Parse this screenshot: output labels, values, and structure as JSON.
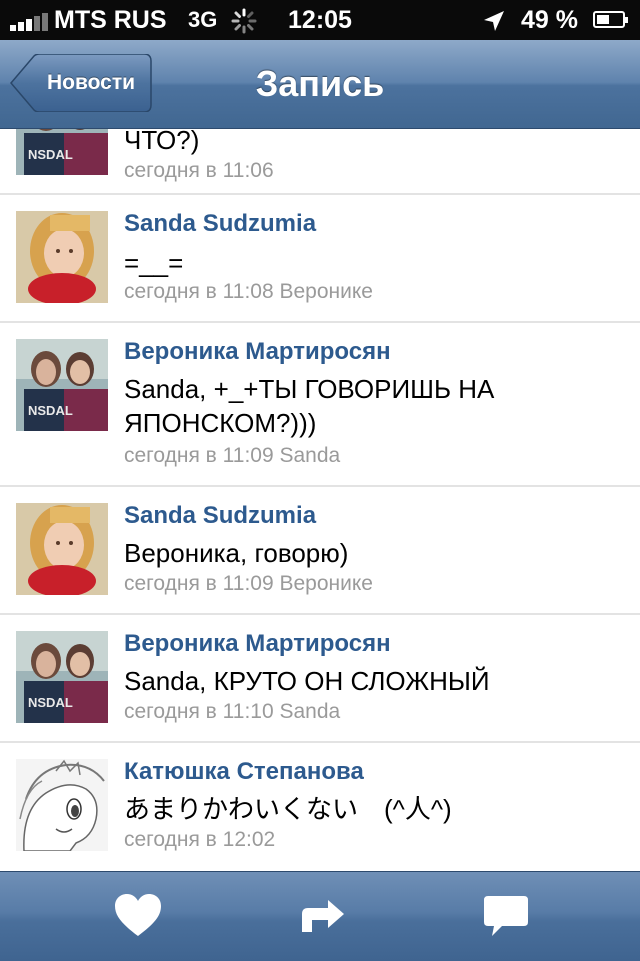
{
  "status_bar": {
    "carrier": "MTS RUS",
    "network": "3G",
    "time": "12:05",
    "battery": "49 %",
    "battery_level": 0.49
  },
  "nav": {
    "back_label": "Новости",
    "title": "Запись"
  },
  "comments": [
    {
      "text": "ЧТО?)",
      "meta": "сегодня в 11:06",
      "avatar": "avatar-veronika"
    },
    {
      "author": "Sanda Sudzumia",
      "text": "=__=",
      "meta": "сегодня в 11:08 Веронике",
      "avatar": "avatar-sanda"
    },
    {
      "author": "Вероника Мартиросян",
      "text": "Sanda, +_+ТЫ ГОВОРИШЬ НА ЯПОНСКОМ?)))",
      "meta": "сегодня в 11:09 Sanda",
      "avatar": "avatar-veronika"
    },
    {
      "author": "Sanda Sudzumia",
      "text": "Вероника, говорю)",
      "meta": "сегодня в 11:09 Веронике",
      "avatar": "avatar-sanda"
    },
    {
      "author": "Вероника Мартиросян",
      "text": "Sanda, КРУТО ОН СЛОЖНЫЙ",
      "meta": "сегодня в 11:10 Sanda",
      "avatar": "avatar-veronika"
    },
    {
      "author": "Катюшка Степанова",
      "text": "あまりかわいくない　(^人^)",
      "meta": "сегодня в 12:02",
      "avatar": "avatar-pony"
    }
  ],
  "toolbar": {
    "buttons": [
      "heart-icon",
      "share-icon",
      "comment-icon"
    ]
  }
}
